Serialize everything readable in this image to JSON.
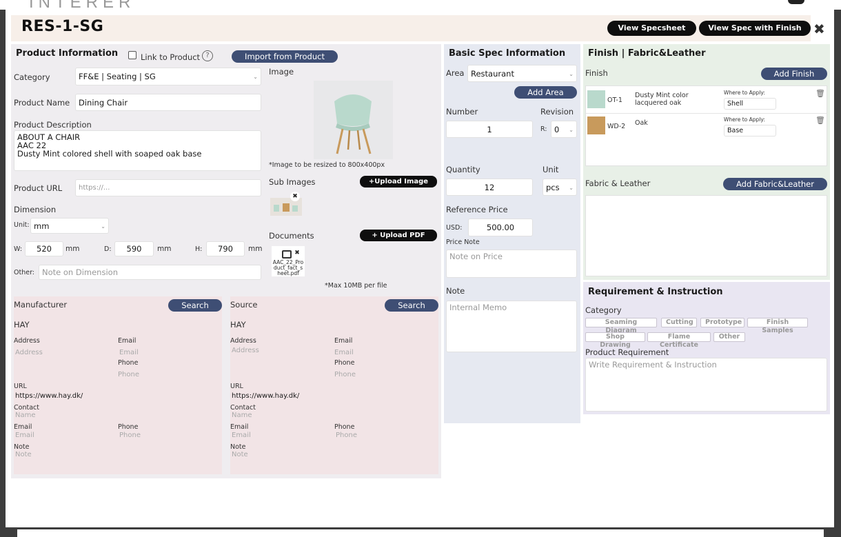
{
  "modal": {
    "title": "RES-1-SG",
    "view_spec_label": "View Specsheet",
    "view_spec_finish_label": "View Spec with Finish",
    "close_icon": "close-icon"
  },
  "product_info": {
    "header": "Product Information",
    "link_to_product": "Link to Product",
    "help": "?",
    "import_label": "Import from Product",
    "category_label": "Category",
    "category_value": "FF&E | Seating | SG",
    "name_label": "Product Name",
    "name_value": "Dining Chair",
    "desc_label": "Product Description",
    "desc_value": "ABOUT A CHAIR\nAAC 22\nDusty Mint colored shell with soaped oak base",
    "url_label": "Product URL",
    "url_placeholder": "https://...",
    "dimension_label": "Dimension",
    "unit_label": "Unit:",
    "unit_value": "mm",
    "w_label": "W:",
    "w_value": "520",
    "d_label": "D:",
    "d_value": "590",
    "h_label": "H:",
    "h_value": "790",
    "mm": "mm",
    "other_label": "Other:",
    "other_placeholder": "Note on Dimension"
  },
  "media": {
    "image_label": "Image",
    "resize_note": "*Image to be resized to 800x400px",
    "sub_images_label": "Sub Images",
    "upload_image_label": "+Upload Image",
    "documents_label": "Documents",
    "upload_pdf_label": "+ Upload PDF",
    "doc_name": "AAC_22_Product_fact_sheet.pdf",
    "max_note": "*Max 10MB per file"
  },
  "manufacturer": {
    "header": "Manufacturer",
    "search_label": "Search",
    "name": "HAY",
    "address_label": "Address",
    "address_placeholder": "Address",
    "email_label": "Email",
    "email_placeholder": "Email",
    "phone_label": "Phone",
    "phone_placeholder": "Phone",
    "url_label": "URL",
    "url_value": "https://www.hay.dk/",
    "contact_label": "Contact",
    "contact_placeholder": "Name",
    "email2_label": "Email",
    "email2_placeholder": "Email",
    "phone2_label": "Phone",
    "phone2_placeholder": "Phone",
    "note_label": "Note",
    "note_placeholder": "Note"
  },
  "source": {
    "header": "Source",
    "search_label": "Search",
    "name": "HAY",
    "address_label": "Address",
    "address_placeholder": "Address",
    "email_label": "Email",
    "email_placeholder": "Email",
    "phone_label": "Phone",
    "phone_placeholder": "Phone",
    "url_label": "URL",
    "url_value": "https://www.hay.dk/",
    "contact_label": "Contact",
    "contact_placeholder": "Name",
    "email2_label": "Email",
    "email2_placeholder": "Email",
    "phone2_label": "Phone",
    "phone2_placeholder": "Phone",
    "note_label": "Note",
    "note_placeholder": "Note"
  },
  "basic_spec": {
    "header": "Basic Spec Information",
    "area_label": "Area",
    "area_value": "Restaurant",
    "add_area_label": "Add Area",
    "number_label": "Number",
    "number_value": "1",
    "revision_label": "Revision",
    "r_label": "R:",
    "revision_value": "0",
    "quantity_label": "Quantity",
    "quantity_value": "12",
    "unit_label": "Unit",
    "unit_value": "pcs",
    "ref_price_label": "Reference Price",
    "usd_label": "USD:",
    "price_value": "500.00",
    "price_note_label": "Price Note",
    "price_note_placeholder": "Note on Price",
    "note_label": "Note",
    "note_placeholder": "Internal Memo"
  },
  "finish": {
    "header": "Finish | Fabric&Leather",
    "finish_label": "Finish",
    "add_finish_label": "Add Finish",
    "where_label": "Where to Apply:",
    "rows": [
      {
        "code": "OT-1",
        "name": "Dusty Mint color lacquered oak",
        "apply": "Shell",
        "color": "#b9d9cc"
      },
      {
        "code": "WD-2",
        "name": "Oak",
        "apply": "Base",
        "color": "#c89a5c"
      }
    ],
    "fabric_label": "Fabric & Leather",
    "add_fabric_label": "Add Fabric&Leather"
  },
  "requirement": {
    "header": "Requirement & Instruction",
    "category_label": "Category",
    "chips": [
      "Seaming Diagram",
      "Cutting",
      "Prototype",
      "Finish Samples",
      "Shop Drawing",
      "Flame Certificate",
      "Other"
    ],
    "product_req_label": "Product Requirement",
    "product_req_placeholder": "Write Requirement & Instruction"
  }
}
